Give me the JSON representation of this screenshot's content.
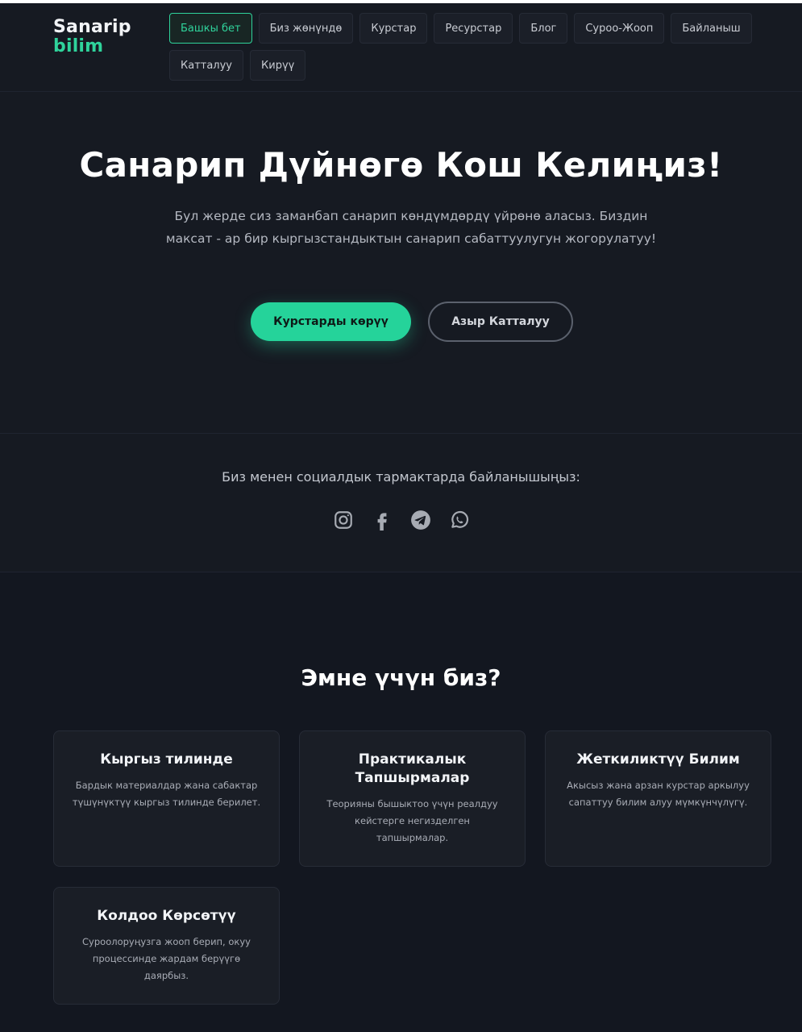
{
  "header": {
    "logo_line1": "Sanarip",
    "logo_line2": "bilim",
    "nav": [
      "Башкы бет",
      "Биз жөнүндө",
      "Курстар",
      "Ресурстар",
      "Блог",
      "Суроо-Жооп",
      "Байланыш",
      "Катталуу",
      "Кирүү"
    ],
    "active_nav": "Башкы бет"
  },
  "hero": {
    "title": "Санарип Дүйнөгө Кош Келиңиз!",
    "text": "Бул жерде сиз заманбап санарип көндүмдөрдү үйрөнө аласыз. Биздин максат - ар бир кыргызстандыктын санарип сабаттуулугун жогорулатуу!",
    "primary_button": "Курстарды көрүү",
    "secondary_button": "Азыр Катталуу"
  },
  "social": {
    "title": "Биз менен социалдык тармактарда байланышыңыз:",
    "icons": [
      "instagram-icon",
      "facebook-icon",
      "telegram-icon",
      "whatsapp-icon"
    ]
  },
  "why": {
    "title": "Эмне үчүн биз?",
    "cards": [
      {
        "title": "Кыргыз тилинде",
        "text": "Бардык материалдар жана сабактар түшүнүктүү кыргыз тилинде берилет."
      },
      {
        "title": "Практикалык Тапшырмалар",
        "text": "Теорияны бышыктоо үчүн реалдуу кейстерге негизделген тапшырмалар."
      },
      {
        "title": "Жеткиликтүү Билим",
        "text": "Акысыз жана арзан курстар аркылуу сапаттуу билим алуу мүмкүнчүлүгү."
      },
      {
        "title": "Колдоо Көрсөтүү",
        "text": "Суроолоруңузга жооп берип, окуу процессинде жардам берүүгө даярбыз."
      }
    ]
  },
  "colors": {
    "accent": "#25d39a",
    "background": "#131720",
    "panel": "#161a22"
  }
}
